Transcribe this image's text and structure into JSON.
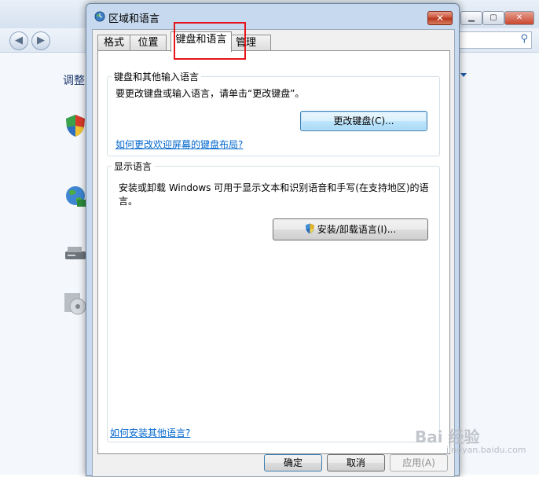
{
  "dialog": {
    "title": "区域和语言",
    "close_label": "✕",
    "tabs": [
      {
        "label": "格式"
      },
      {
        "label": "位置"
      },
      {
        "label": "键盘和语言"
      },
      {
        "label": "管理"
      }
    ],
    "keyboard_group": {
      "title": "键盘和其他输入语言",
      "text": "要更改键盘或输入语言，请单击“更改键盘”。",
      "change_keyboard_button": "更改键盘(C)...",
      "welcome_screen_link": "如何更改欢迎屏幕的键盘布局?"
    },
    "display_group": {
      "title": "显示语言",
      "text_line1": "安装或卸载 Windows 可用于显示文本和识别语音和手写(在支持地区)的语",
      "text_line2": "言。",
      "install_button": "安装/卸载语言(I)..."
    },
    "install_other_link": "如何安装其他语言?",
    "ok_button": "确定",
    "cancel_button": "取消",
    "apply_button": "应用(A)"
  },
  "background": {
    "partial_text": "调整",
    "back_glyph": "◀",
    "forward_glyph": "▶",
    "search_icon_glyph": "⚲",
    "min_glyph": "▁",
    "max_glyph": "▢",
    "close_glyph": "✕"
  },
  "watermark": {
    "brand": "Bai 经验",
    "sub": "jingyan.baidu.com"
  },
  "colors": {
    "highlight": "#e4161c",
    "link": "#0066cc",
    "titlebar": "#c7d9ee"
  }
}
